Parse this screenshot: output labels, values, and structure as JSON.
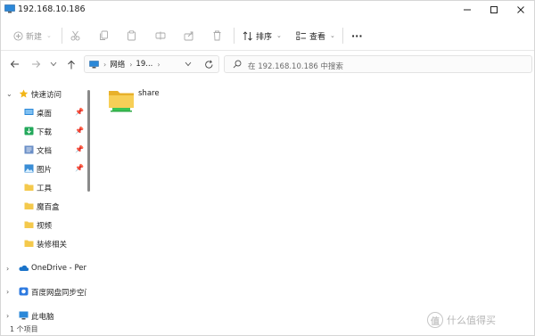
{
  "window": {
    "title": "192.168.10.186"
  },
  "commandbar": {
    "new_label": "新建",
    "sort_label": "排序",
    "view_label": "查看",
    "more_label": "···"
  },
  "address": {
    "crumbs": [
      "网络",
      "19..."
    ]
  },
  "search": {
    "placeholder": "在 192.168.10.186 中搜索"
  },
  "sidebar": {
    "quick_access": "快速访问",
    "items": [
      {
        "label": "桌面",
        "icon": "desktop-folder-icon",
        "pinned": true
      },
      {
        "label": "下载",
        "icon": "download-folder-icon",
        "pinned": true
      },
      {
        "label": "文档",
        "icon": "documents-folder-icon",
        "pinned": true
      },
      {
        "label": "图片",
        "icon": "pictures-folder-icon",
        "pinned": true
      },
      {
        "label": "工具",
        "icon": "folder-icon",
        "pinned": false
      },
      {
        "label": "魔百盒",
        "icon": "folder-icon",
        "pinned": false
      },
      {
        "label": "视频",
        "icon": "folder-icon",
        "pinned": false
      },
      {
        "label": "装修相关",
        "icon": "folder-icon",
        "pinned": false
      }
    ],
    "onedrive": "OneDrive - Pers",
    "baidu": "百度网盘同步空间",
    "this_pc": "此电脑"
  },
  "content": {
    "files": [
      {
        "name": "share",
        "icon": "network-share-folder-icon"
      }
    ]
  },
  "status": {
    "count_text": "1 个项目"
  },
  "watermark": {
    "badge": "值",
    "text": "什么值得买"
  },
  "colors": {
    "folder": "#f4c94c",
    "accent": "#1a73c9",
    "share_bar": "#3cc454"
  }
}
